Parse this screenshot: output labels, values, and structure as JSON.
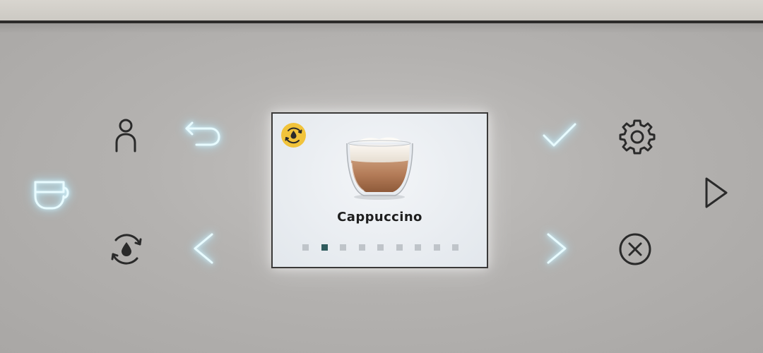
{
  "display": {
    "drink_name": "Cappuccino",
    "badge_icon": "descale-water-drop-icon",
    "image_icon": "cappuccino-cup-icon",
    "page_indicator": {
      "total": 9,
      "active": 2
    }
  },
  "buttons": [
    {
      "icon": "cup-icon",
      "lit": true
    },
    {
      "icon": "user-profile-icon",
      "lit": false
    },
    {
      "icon": "back-arrow-icon",
      "lit": true
    },
    {
      "icon": "descale-icon",
      "lit": false
    },
    {
      "icon": "chevron-left-icon",
      "lit": true
    },
    {
      "icon": "checkmark-icon",
      "lit": true
    },
    {
      "icon": "gear-icon",
      "lit": false
    },
    {
      "icon": "chevron-right-icon",
      "lit": true
    },
    {
      "icon": "cancel-icon",
      "lit": false
    },
    {
      "icon": "play-icon",
      "lit": false
    }
  ],
  "colors": {
    "panel": "#b4b2b0",
    "icon_dark": "#2a2a2a",
    "icon_lit": "#e8fbff",
    "badge": "#f1c33b",
    "indicator_active": "#2f5b5d",
    "indicator_inactive": "#bfc4c9"
  }
}
